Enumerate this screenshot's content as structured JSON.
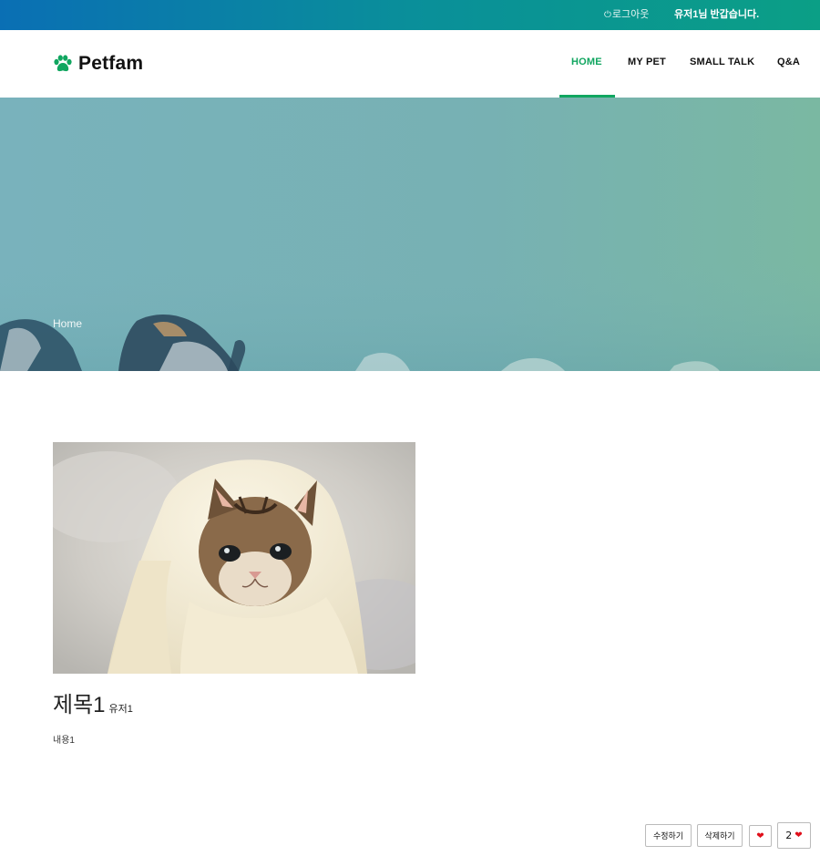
{
  "topbar": {
    "logout_icon": "power-icon",
    "logout_label": "로그아웃",
    "greeting": "유저1님 반갑습니다."
  },
  "header": {
    "logo_icon": "paw-icon",
    "logo_text": "Petfam",
    "nav": [
      {
        "label": "HOME",
        "active": true
      },
      {
        "label": "MY PET",
        "active": false
      },
      {
        "label": "SMALL TALK",
        "active": false
      },
      {
        "label": "Q&A",
        "active": false
      }
    ],
    "accent_color": "#11a660"
  },
  "hero": {
    "breadcrumb": "Home"
  },
  "post": {
    "title": "제목1",
    "author": "유저1",
    "content": "내용1",
    "likes": "2"
  },
  "actions": {
    "edit_label": "수정하기",
    "delete_label": "삭제하기",
    "like_icon": "heart-icon"
  }
}
